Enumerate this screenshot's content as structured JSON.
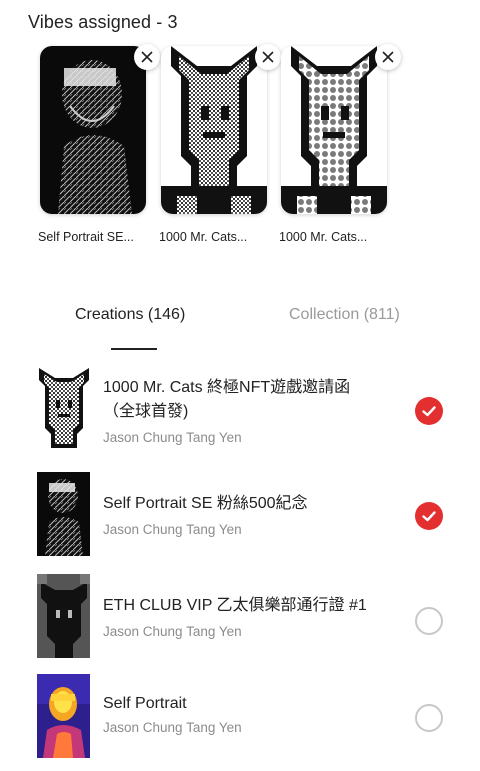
{
  "header": {
    "title": "Vibes assigned - 3"
  },
  "assigned": [
    {
      "caption": "Self Portrait SE...",
      "art": "portrait-bw"
    },
    {
      "caption": "1000 Mr. Cats...",
      "art": "cat-dither"
    },
    {
      "caption": "1000 Mr. Cats...",
      "art": "cat-dots"
    }
  ],
  "tabs": [
    {
      "label": "Creations (146)",
      "active": true
    },
    {
      "label": "Collection (811)",
      "active": false
    }
  ],
  "creations": [
    {
      "title_line1": "1000 Mr. Cats 終極NFT遊戲邀請函",
      "title_line2": "（全球首發)",
      "author": "Jason Chung Tang Yen",
      "selected": true
    },
    {
      "title_line1": "Self Portrait SE 粉絲500紀念",
      "title_line2": "",
      "author": "Jason Chung Tang Yen",
      "selected": true
    },
    {
      "title_line1": "ETH CLUB VIP 乙太俱樂部通行證 #1",
      "title_line2": "",
      "author": "Jason Chung Tang Yen",
      "selected": false
    },
    {
      "title_line1": "Self Portrait",
      "title_line2": "",
      "author": "Jason Chung Tang Yen",
      "selected": false
    }
  ],
  "colors": {
    "accent": "#e32f2f",
    "muted": "#8c8c8c"
  }
}
